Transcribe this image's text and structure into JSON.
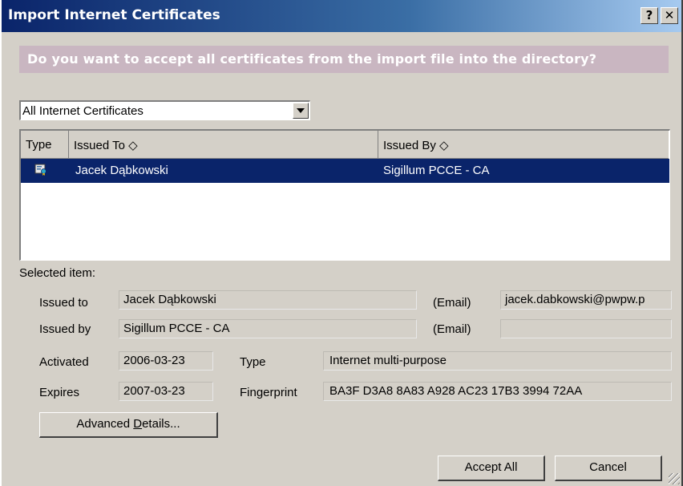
{
  "window": {
    "title": "Import Internet Certificates"
  },
  "titlebar": {
    "help": "?",
    "close": "✕"
  },
  "banner": {
    "text": "Do you want to accept all certificates from the import file into the directory?"
  },
  "filter": {
    "selected": "All Internet Certificates"
  },
  "list": {
    "columns": {
      "type": "Type",
      "issued_to": "Issued To ◇",
      "issued_by": "Issued By ◇"
    },
    "rows": [
      {
        "icon": "certificate-icon",
        "issued_to": "Jacek Dąbkowski",
        "issued_by": "Sigillum PCCE - CA"
      }
    ]
  },
  "details": {
    "heading": "Selected item:",
    "issued_to_label": "Issued to",
    "issued_to": "Jacek Dąbkowski",
    "email_label_1": "(Email)",
    "email_1": "jacek.dabkowski@pwpw.p",
    "issued_by_label": "Issued by",
    "issued_by": "Sigillum PCCE - CA",
    "email_label_2": "(Email)",
    "email_2": "",
    "activated_label": "Activated",
    "activated": "2006-03-23",
    "type_label": "Type",
    "type": "Internet multi-purpose",
    "expires_label": "Expires",
    "expires": "2007-03-23",
    "fingerprint_label": "Fingerprint",
    "fingerprint": "BA3F D3A8 8A83 A928 AC23 17B3 3994 72AA"
  },
  "buttons": {
    "advanced_pre": "Advanced ",
    "advanced_key": "D",
    "advanced_post": "etails...",
    "accept_all": "Accept All",
    "cancel": "Cancel"
  }
}
